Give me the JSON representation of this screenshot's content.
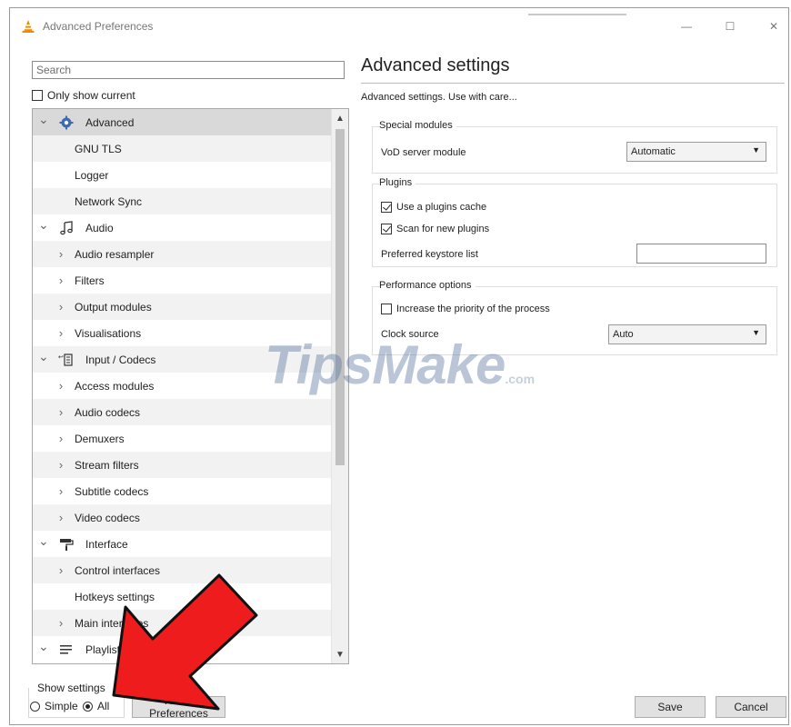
{
  "window": {
    "title": "Advanced Preferences",
    "minimize_glyph": "—",
    "maximize_glyph": "☐",
    "close_glyph": "✕"
  },
  "search": {
    "placeholder": "Search",
    "value": ""
  },
  "only_show_current": {
    "label": "Only show current",
    "checked": false
  },
  "tree": {
    "items": [
      {
        "label": "Advanced",
        "level": 0,
        "expanded": true,
        "icon": "gear-icon",
        "selected": true
      },
      {
        "label": "GNU TLS",
        "level": 1
      },
      {
        "label": "Logger",
        "level": 1
      },
      {
        "label": "Network Sync",
        "level": 1
      },
      {
        "label": "Audio",
        "level": 0,
        "expanded": true,
        "icon": "music-note-icon"
      },
      {
        "label": "Audio resampler",
        "level": 1,
        "has_children": true
      },
      {
        "label": "Filters",
        "level": 1,
        "has_children": true
      },
      {
        "label": "Output modules",
        "level": 1,
        "has_children": true
      },
      {
        "label": "Visualisations",
        "level": 1,
        "has_children": true
      },
      {
        "label": "Input / Codecs",
        "level": 0,
        "expanded": true,
        "icon": "codec-icon"
      },
      {
        "label": "Access modules",
        "level": 1,
        "has_children": true
      },
      {
        "label": "Audio codecs",
        "level": 1,
        "has_children": true
      },
      {
        "label": "Demuxers",
        "level": 1,
        "has_children": true
      },
      {
        "label": "Stream filters",
        "level": 1,
        "has_children": true
      },
      {
        "label": "Subtitle codecs",
        "level": 1,
        "has_children": true
      },
      {
        "label": "Video codecs",
        "level": 1,
        "has_children": true
      },
      {
        "label": "Interface",
        "level": 0,
        "expanded": true,
        "icon": "paint-roller-icon"
      },
      {
        "label": "Control interfaces",
        "level": 1,
        "has_children": true
      },
      {
        "label": "Hotkeys settings",
        "level": 1
      },
      {
        "label": "Main interfaces",
        "level": 1,
        "has_children": true
      },
      {
        "label": "Playlist",
        "level": 0,
        "expanded": true,
        "icon": "playlist-icon"
      }
    ]
  },
  "show_settings": {
    "label": "Show settings",
    "simple_label": "Simple",
    "all_label": "All",
    "selected": "All"
  },
  "buttons": {
    "reset": "Reset Preferences",
    "save": "Save",
    "cancel": "Cancel"
  },
  "right": {
    "title": "Advanced settings",
    "subtitle": "Advanced settings. Use with care...",
    "special_modules": {
      "label": "Special modules",
      "vod_label": "VoD server module",
      "vod_value": "Automatic"
    },
    "plugins": {
      "label": "Plugins",
      "use_cache_label": "Use a plugins cache",
      "use_cache_checked": true,
      "scan_label": "Scan for new plugins",
      "scan_checked": true,
      "keystore_label": "Preferred keystore list",
      "keystore_value": ""
    },
    "performance": {
      "label": "Performance options",
      "priority_label": "Increase the priority of the process",
      "priority_checked": false,
      "clock_label": "Clock source",
      "clock_value": "Auto"
    }
  },
  "watermark": {
    "text": "TipsMake",
    "suffix": ".com"
  },
  "colors": {
    "arrow_red": "#ee1c1c",
    "selection": "#d9d9d9",
    "alt_row": "#f2f2f2",
    "vlc_orange": "#f08a00"
  }
}
